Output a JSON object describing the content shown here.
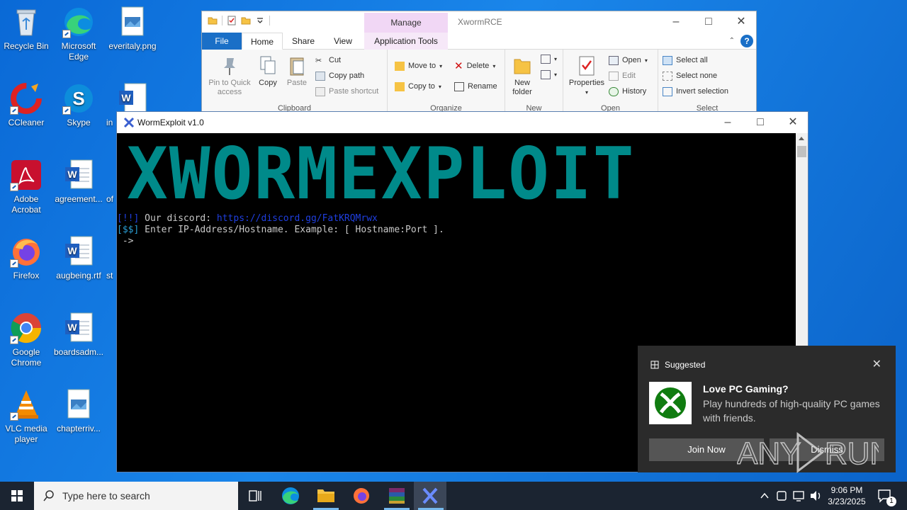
{
  "desktop_icons": [
    {
      "id": "recycle-bin",
      "label": "Recycle Bin"
    },
    {
      "id": "microsoft-edge",
      "label": "Microsoft\nEdge"
    },
    {
      "id": "everitaly",
      "label": "everitaly.png"
    },
    {
      "id": "ccleaner",
      "label": "CCleaner"
    },
    {
      "id": "skype",
      "label": "Skype"
    },
    {
      "id": "word-partial",
      "label": "in"
    },
    {
      "id": "adobe-acrobat",
      "label": "Adobe\nAcrobat"
    },
    {
      "id": "agreement",
      "label": "agreement..."
    },
    {
      "id": "of-partial",
      "label": "of"
    },
    {
      "id": "firefox",
      "label": "Firefox"
    },
    {
      "id": "augbeing",
      "label": "augbeing.rtf"
    },
    {
      "id": "st-partial",
      "label": "st"
    },
    {
      "id": "google-chrome",
      "label": "Google\nChrome"
    },
    {
      "id": "boardsadm",
      "label": "boardsadm..."
    },
    {
      "id": "vlc",
      "label": "VLC media\nplayer"
    },
    {
      "id": "chapterriv",
      "label": "chapterriv..."
    }
  ],
  "explorer": {
    "title": "XwormRCE",
    "manage_tab": "Manage",
    "tabs": {
      "file": "File",
      "home": "Home",
      "share": "Share",
      "view": "View",
      "app_tools": "Application Tools"
    },
    "clipboard": {
      "pin": "Pin to Quick\naccess",
      "copy": "Copy",
      "paste": "Paste",
      "cut": "Cut",
      "copy_path": "Copy path",
      "paste_shortcut": "Paste shortcut",
      "group": "Clipboard"
    },
    "organize": {
      "move_to": "Move to",
      "copy_to": "Copy to",
      "delete": "Delete",
      "rename": "Rename",
      "group": "Organize"
    },
    "new": {
      "new_folder": "New\nfolder",
      "group": "New"
    },
    "open": {
      "properties": "Properties",
      "open": "Open",
      "edit": "Edit",
      "history": "History",
      "group": "Open"
    },
    "select": {
      "select_all": "Select all",
      "select_none": "Select none",
      "invert": "Invert selection",
      "group": "Select"
    }
  },
  "terminal": {
    "title": "WormExploit v1.0",
    "banner": "XWORMEXPLOIT",
    "line1_prefix": "[!!]",
    "line1_text": " Our discord: ",
    "line1_link": "https://discord.gg/FatKRQMrwx",
    "line2_prefix": "[$$]",
    "line2_text": " Enter IP-Address/Hostname. Example: [ Hostname:Port ].",
    "prompt": " ->"
  },
  "toast": {
    "header": "Suggested",
    "title": "Love PC Gaming?",
    "description": "Play hundreds of high-quality PC games with friends.",
    "join": "Join Now",
    "dismiss": "Dismiss",
    "watermark": "ANY RUN"
  },
  "taskbar": {
    "search_placeholder": "Type here to search",
    "time": "9:06 PM",
    "date": "3/23/2025",
    "notification_count": "1"
  },
  "colors": {
    "banner": "#008a8a",
    "discord_link": "#1f3fe0",
    "prompt_prefix": "#2a9fd6",
    "file_tab": "#1a6fc7",
    "manage_tab": "#f1d7f5"
  }
}
